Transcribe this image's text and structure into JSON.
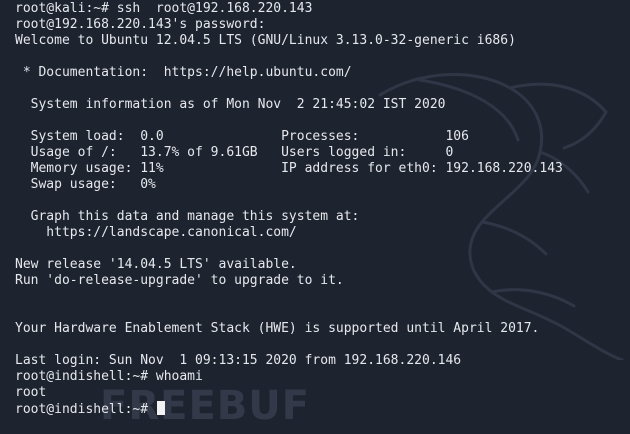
{
  "terminal": {
    "lines": [
      "root@kali:~# ssh  root@192.168.220.143",
      "root@192.168.220.143's password: ",
      "Welcome to Ubuntu 12.04.5 LTS (GNU/Linux 3.13.0-32-generic i686)",
      "",
      " * Documentation:  https://help.ubuntu.com/",
      "",
      "  System information as of Mon Nov  2 21:45:02 IST 2020",
      "",
      "  System load:  0.0               Processes:           106",
      "  Usage of /:   13.7% of 9.61GB   Users logged in:     0",
      "  Memory usage: 11%               IP address for eth0: 192.168.220.143",
      "  Swap usage:   0%",
      "",
      "  Graph this data and manage this system at:",
      "    https://landscape.canonical.com/",
      "",
      "New release '14.04.5 LTS' available.",
      "Run 'do-release-upgrade' to upgrade to it.",
      "",
      "",
      "Your Hardware Enablement Stack (HWE) is supported until April 2017.",
      "",
      "Last login: Sun Nov  1 09:13:15 2020 from 192.168.220.146",
      "root@indishell:~# whoami",
      "root",
      "root@indishell:~# "
    ]
  },
  "watermark": {
    "text": "FREEBUF"
  },
  "icons": {
    "background": "kali-dragon-icon",
    "cursor": "block-cursor-icon"
  },
  "colors": {
    "background": "#1e2330",
    "text": "#e6e8ec",
    "cursor": "#f2f2f2"
  }
}
